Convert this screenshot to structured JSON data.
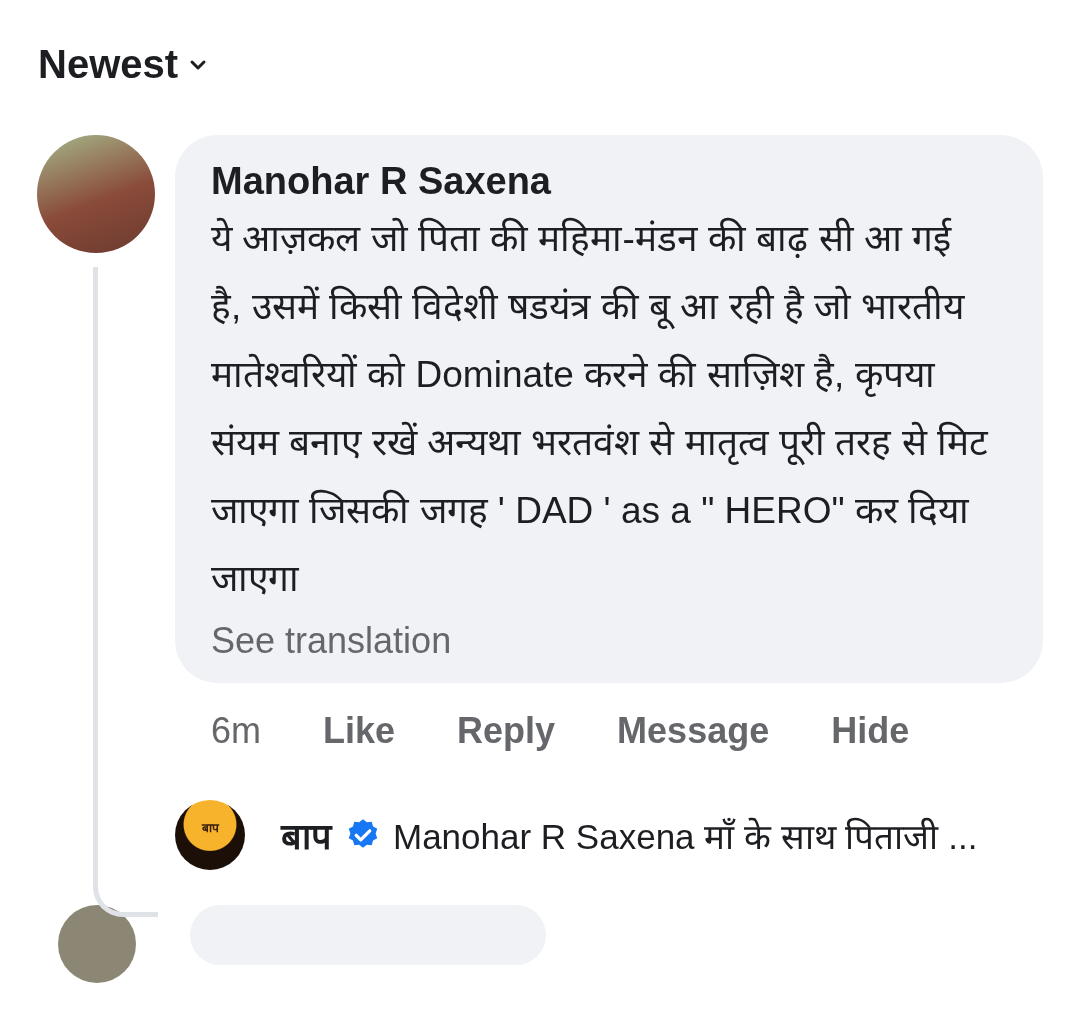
{
  "sort": {
    "label": "Newest"
  },
  "comment": {
    "author": "Manohar R Saxena",
    "text": "ये आज़कल जो पिता की महिमा-मंडन की बाढ़ सी आ गई है, उसमें किसी विदेशी षडयंत्र की बू आ रही है जो भारतीय मातेश्वरियों को Dominate करने की साज़िश है, कृपया संयम बनाए रखें अन्यथा भरतवंश से मातृत्व पूरी तरह से मिट जाएगा जिसकी जगह ' DAD ' as a \" HERO\"  कर दिया जाएगा",
    "translate": "See translation",
    "time": "6m",
    "actions": [
      "Like",
      "Reply",
      "Message",
      "Hide"
    ]
  },
  "reply": {
    "avatar_text": "बाप",
    "author": "बाप",
    "verified": true,
    "preview": "Manohar R Saxena माँ के साथ पिताजी ..."
  }
}
